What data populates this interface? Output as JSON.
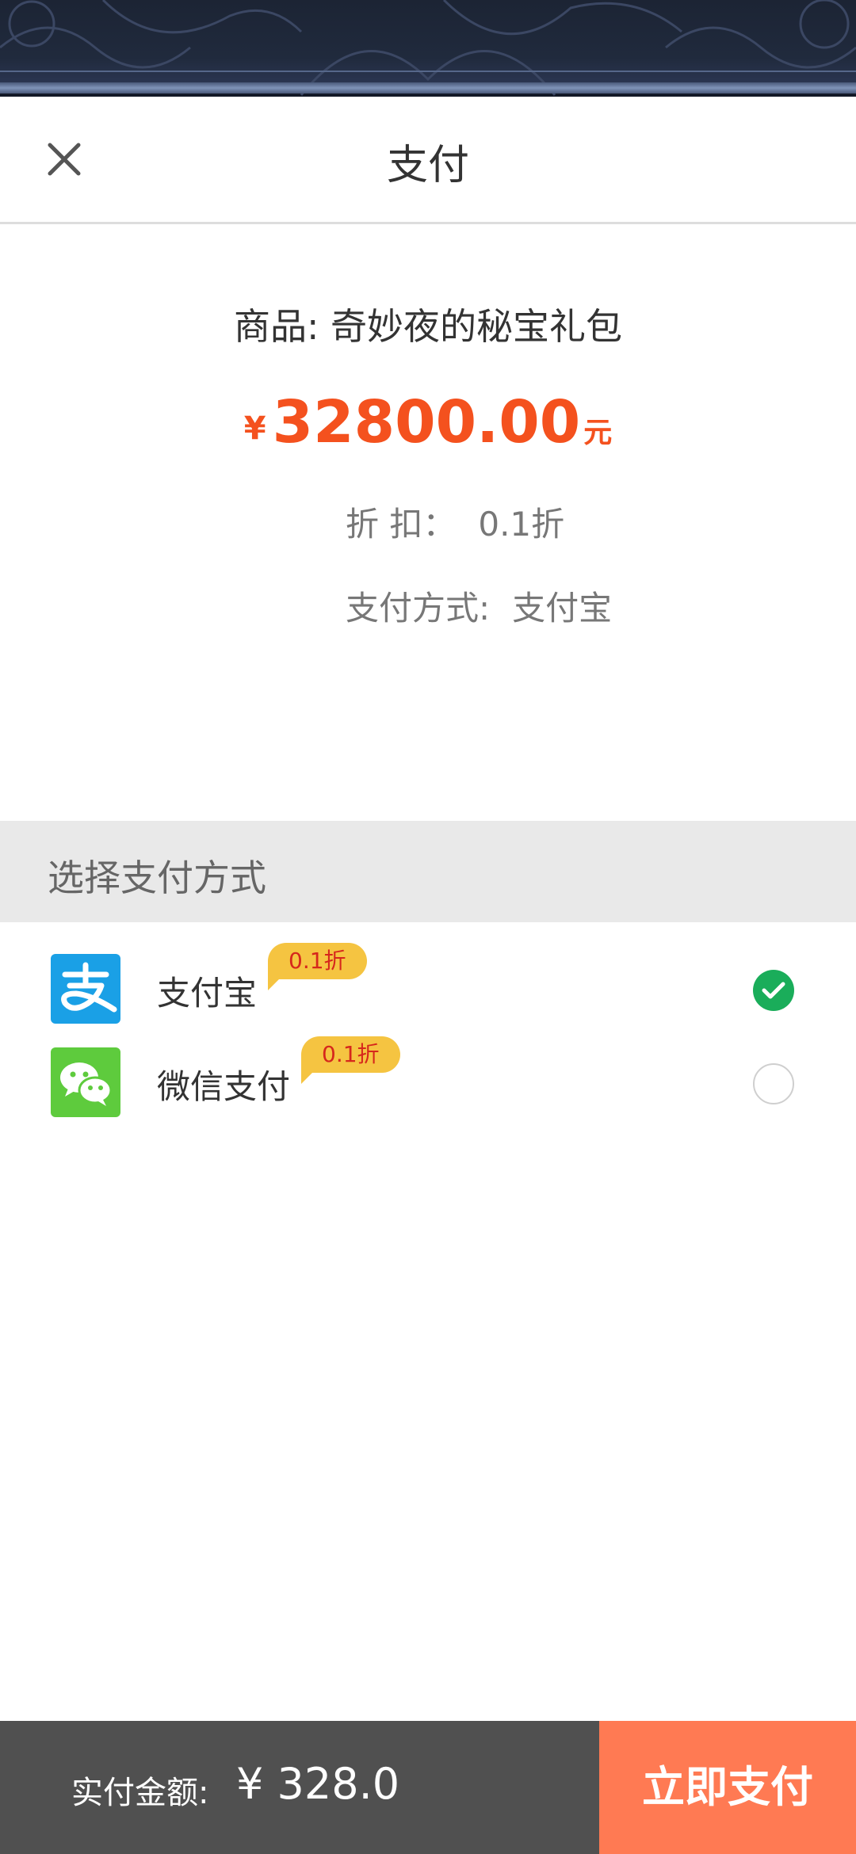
{
  "header": {
    "title": "支付",
    "close_icon": "close-icon"
  },
  "product": {
    "name": "商品: 奇妙夜的秘宝礼包",
    "currency_symbol": "¥",
    "price": "32800.00",
    "unit": "元",
    "discount_label": "折 扣：",
    "discount_value": "0.1折",
    "method_label": "支付方式:",
    "method_value": "支付宝"
  },
  "payment_section": {
    "title": "选择支付方式",
    "options": [
      {
        "label": "支付宝",
        "badge": "0.1折",
        "icon": "alipay-icon",
        "selected": true
      },
      {
        "label": "微信支付",
        "badge": "0.1折",
        "icon": "wechat-icon",
        "selected": false
      }
    ]
  },
  "footer": {
    "amount_label": "实付金额:",
    "amount_value": "¥ 328.0",
    "pay_button": "立即支付"
  },
  "colors": {
    "price": "#f4511e",
    "badge": "#f5c441",
    "selected": "#1aad5a",
    "pay_button": "#ff7a53",
    "footer_bg": "#505050",
    "alipay": "#1aa0e6",
    "wechat": "#5ecb3d"
  }
}
